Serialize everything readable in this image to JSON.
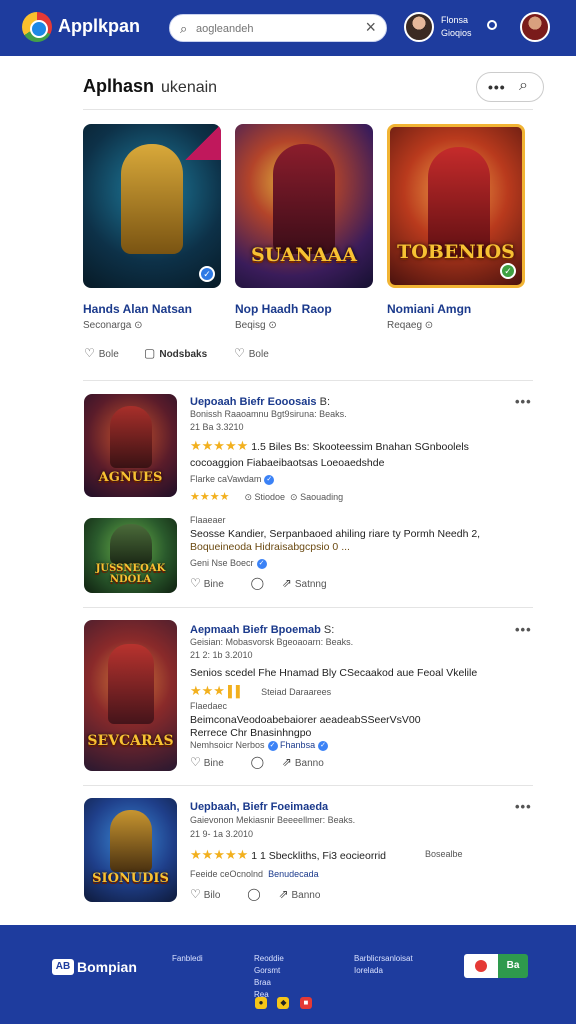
{
  "header": {
    "app_title": "Applkpan",
    "search_placeholder": "aogleandeh",
    "user_name_line1": "Flonsa",
    "user_name_line2": "Gioqios"
  },
  "section": {
    "title": "Aplhasn",
    "subtitle": "ukenain"
  },
  "featured": [
    {
      "caption": "",
      "title": "Hands Alan Natsan",
      "sub": "Seconarga ⊙",
      "badge_color": "#2f7ae5"
    },
    {
      "caption": "SUANAAA",
      "title": "Nop Haadh Raop",
      "sub": "Beqisg ⊙",
      "badge_color": ""
    },
    {
      "caption": "TOBENIOS",
      "title": "Nomiani Amgn",
      "sub": "Reqaeg ⊙",
      "badge_color": "#3fa142"
    }
  ],
  "featured_actions": {
    "like": "Bole",
    "save": "Nodsbaks",
    "share": "Bole"
  },
  "items": [
    {
      "caption": "AGNUES",
      "title": "Uepoaah Biefr Eooosais",
      "title_tail": "B:",
      "meta1": "Bonissh Raaoamnu Bgt9siruna: Beaks.",
      "meta2": "21  Ba 3.3210",
      "rating_text": "1.5 Biles Bs: Skooteessim Bnahan SGnboolels",
      "desc": "cocoaggion Fiabaeibaotsas  Loeoaedshde",
      "author": "Flarke caVawdam",
      "stat1": "Stiodoe",
      "stat2": "Saouading"
    },
    {
      "caption": "JUSSNEOAK\nNDOLA",
      "small": "Flaaeaer",
      "desc1": "Seosse Kandier, Serpanbaoed ahiling riare ty Pormh Needh 2,",
      "desc2": "Boqueineoda Hidraisabgcpsio 0 ...",
      "author": "Geni Nse Boecr",
      "like": "Bine",
      "share": "Satnng"
    },
    {
      "caption": "SEVCARAS",
      "title": "Aepmaah Biefr Bpoemab",
      "title_tail": "S:",
      "meta1": "Geisian: Mobasvorsk Bgeoaoarn: Beaks.",
      "meta2": "21  2: 1b 3.2010",
      "rating_head": "Senios scedel",
      "rating_text": "Fhe Hnamad Bly CSecaakod aue Feoal Vkelile",
      "rating_note": "Steiad Daraarees",
      "small": "Flaedaec",
      "desc1": "BeimconaVeodoabebaiorer aeadeabSSeerVsV00",
      "desc2": "Rerrece Chr Bnasinhngpo",
      "author": "Nemhsoicr Nerbos",
      "author_link": "Fhanbsa",
      "like": "Bine",
      "share": "Banno"
    },
    {
      "caption": "SIONUDIS",
      "title": "Uepbaah, Biefr Foeimaeda",
      "title_tail": "",
      "meta1": "Gaievonon Mekiasnir Beeeellmer: Beaks.",
      "meta2": "21  9- 1a 3.2010",
      "rating_text": "1 1 Sbeckliths, Fi3 eocieorrid",
      "rating_note": "Bosealbe",
      "author": "Feeide ceOcnolnd",
      "author_link": "Benudecada",
      "like": "Bilo",
      "share": "Banno"
    }
  ],
  "footer": {
    "brand": "Bompian",
    "col1": [
      "Fanbledi"
    ],
    "col2": [
      "Reoddie",
      "Gorsmt",
      "Braa",
      "Rea"
    ],
    "col3": [
      "Barblicrsanloisat",
      "Iorelada"
    ],
    "btn_label": "Ba"
  },
  "colors": {
    "brand_blue": "#1e3c9e",
    "link_blue": "#1b3a8c",
    "star_gold": "#f2b01e",
    "verified_blue": "#3b82f6",
    "cta_green": "#2e9a4d"
  }
}
